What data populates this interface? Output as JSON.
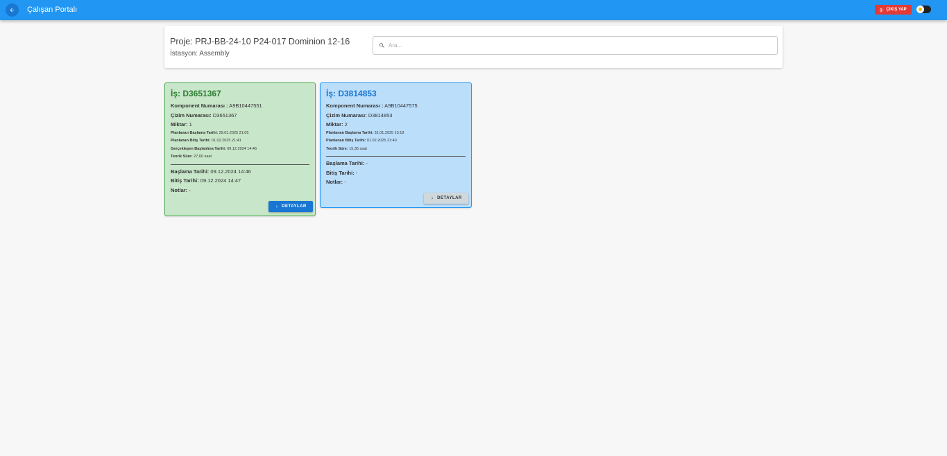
{
  "appbar": {
    "title": "Çalışan Portalı",
    "logout_label": "ÇIKIŞ YAP",
    "accent": "#2196f3",
    "logout_color": "#e53935"
  },
  "header": {
    "project": "Proje: PRJ-BB-24-10 P24-017 Dominion 12-16",
    "station": "İstasyon: Assembly",
    "search_placeholder": "Ara..."
  },
  "jobs": [
    {
      "title": "İş: D3651367",
      "component_label": "Komponent Numarası :",
      "component_value": " A9B10447551",
      "drawing_label": "Çizim Numarası:",
      "drawing_value": " D3651367",
      "quantity_label": "Miktar:",
      "quantity_value": " 1",
      "planned_start_label": "Planlanan Başlama Tarihi:",
      "planned_start_value": " 29.01.2025 21:05",
      "planned_end_label": "Planlanan Bitiş Tarihi:",
      "planned_end_value": " 01.02.2025 21:41",
      "actual_start_label": "Gerçekleşen Başlatılma Tarihi:",
      "actual_start_value": " 09.12.2024 14:46",
      "theoretical_label": "Teorik Süre:",
      "theoretical_value": " 27,60 saat",
      "start_label": "Başlama Tarihi:",
      "start_value": " 09.12.2024 14:46",
      "end_label": "Bitiş Tarihi:",
      "end_value": " 09.12.2024 14:47",
      "notes_label": "Notlar:",
      "notes_value": " -",
      "button_label": "DETAYLAR",
      "status_color": "#4caf50"
    },
    {
      "title": "İş: D3814853",
      "component_label": "Komponent Numarası :",
      "component_value": " A9B10447575",
      "drawing_label": "Çizim Numarası:",
      "drawing_value": " D3814853",
      "quantity_label": "Miktar:",
      "quantity_value": " 2",
      "planned_start_label": "Planlanan Başlama Tarihi:",
      "planned_start_value": " 31.01.2025 15:19",
      "planned_end_label": "Planlanan Bitiş Tarihi:",
      "planned_end_value": " 01.02.2025 21:40",
      "theoretical_label": "Teorik Süre:",
      "theoretical_value": " 15,35 saat",
      "start_label": "Başlama Tarihi:",
      "start_value": " -",
      "end_label": "Bitiş Tarihi:",
      "end_value": " -",
      "notes_label": "Notlar:",
      "notes_value": " -",
      "button_label": "DETAYLAR",
      "status_color": "#2196f3"
    }
  ]
}
